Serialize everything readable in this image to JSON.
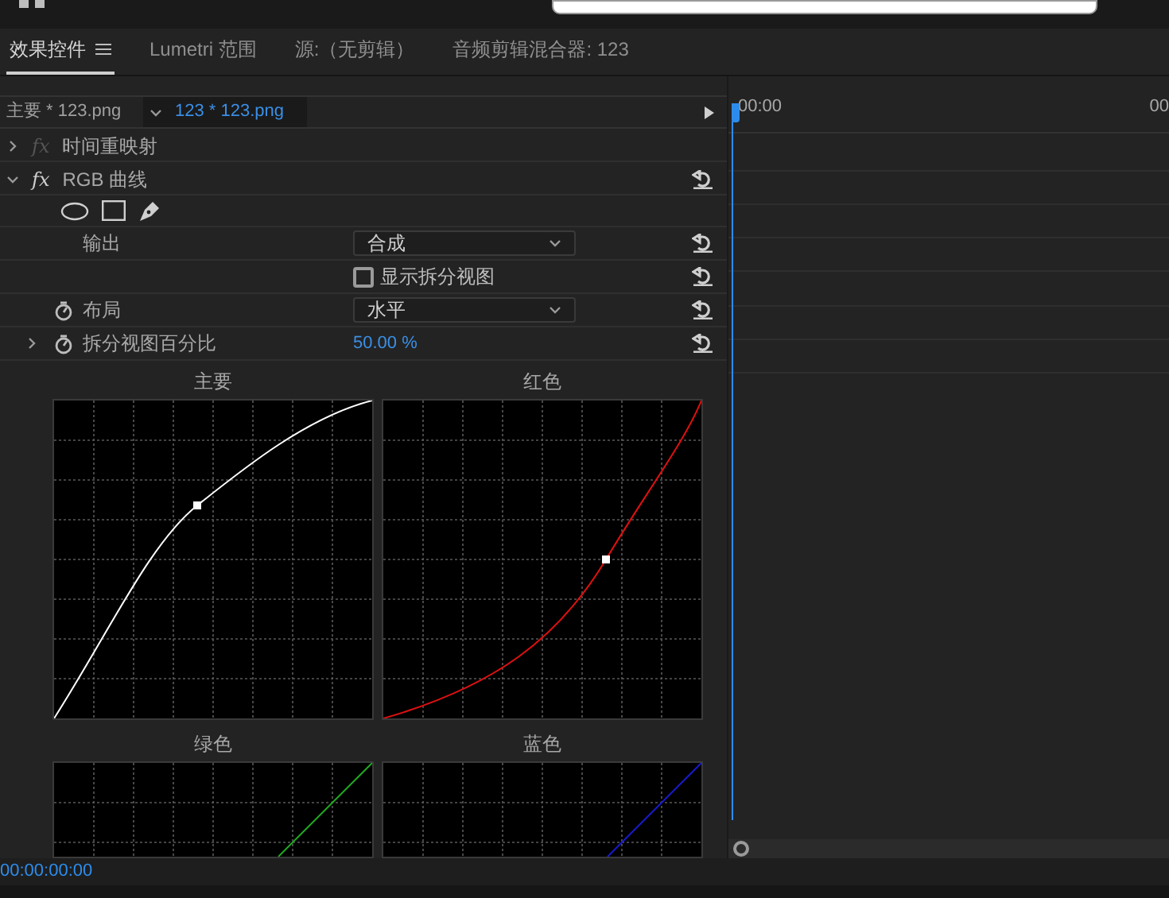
{
  "tabs": [
    {
      "label": "效果控件",
      "selected": true,
      "menu": true
    },
    {
      "label": "Lumetri 范围",
      "selected": false,
      "menu": false
    },
    {
      "label": "源:（无剪辑）",
      "selected": false,
      "menu": false
    },
    {
      "label": "音频剪辑混合器: 123",
      "selected": false,
      "menu": false
    }
  ],
  "clip_header": {
    "master": "主要 * 123.png",
    "clip": "123 * 123.png"
  },
  "effects": [
    {
      "icon_text": "fx",
      "name": "时间重映射",
      "expanded": false,
      "enabled": false
    },
    {
      "icon_text": "fx",
      "name": "RGB 曲线",
      "expanded": true,
      "enabled": true
    }
  ],
  "properties": [
    {
      "kind": "dropdown",
      "label": "输出",
      "value": "合成",
      "stopwatch": false,
      "expandable": false
    },
    {
      "kind": "checkbox",
      "label": "显示拆分视图",
      "checked": false,
      "stopwatch": false,
      "expandable": false
    },
    {
      "kind": "dropdown",
      "label": "布局",
      "value": "水平",
      "stopwatch": true,
      "expandable": false
    },
    {
      "kind": "number",
      "label": "拆分视图百分比",
      "value": "50.00 %",
      "stopwatch": true,
      "expandable": true
    }
  ],
  "curves": [
    {
      "title": "主要",
      "color": "#ffffff",
      "kind": "convex"
    },
    {
      "title": "红色",
      "color": "#e01010",
      "kind": "concave"
    },
    {
      "title": "绿色",
      "color": "#1faa1f",
      "kind": "linear"
    },
    {
      "title": "蓝色",
      "color": "#1a1acc",
      "kind": "linear"
    }
  ],
  "timeline": {
    "ruler_labels": [
      "00:00",
      "00"
    ]
  },
  "timecode": "00:00:00:00"
}
